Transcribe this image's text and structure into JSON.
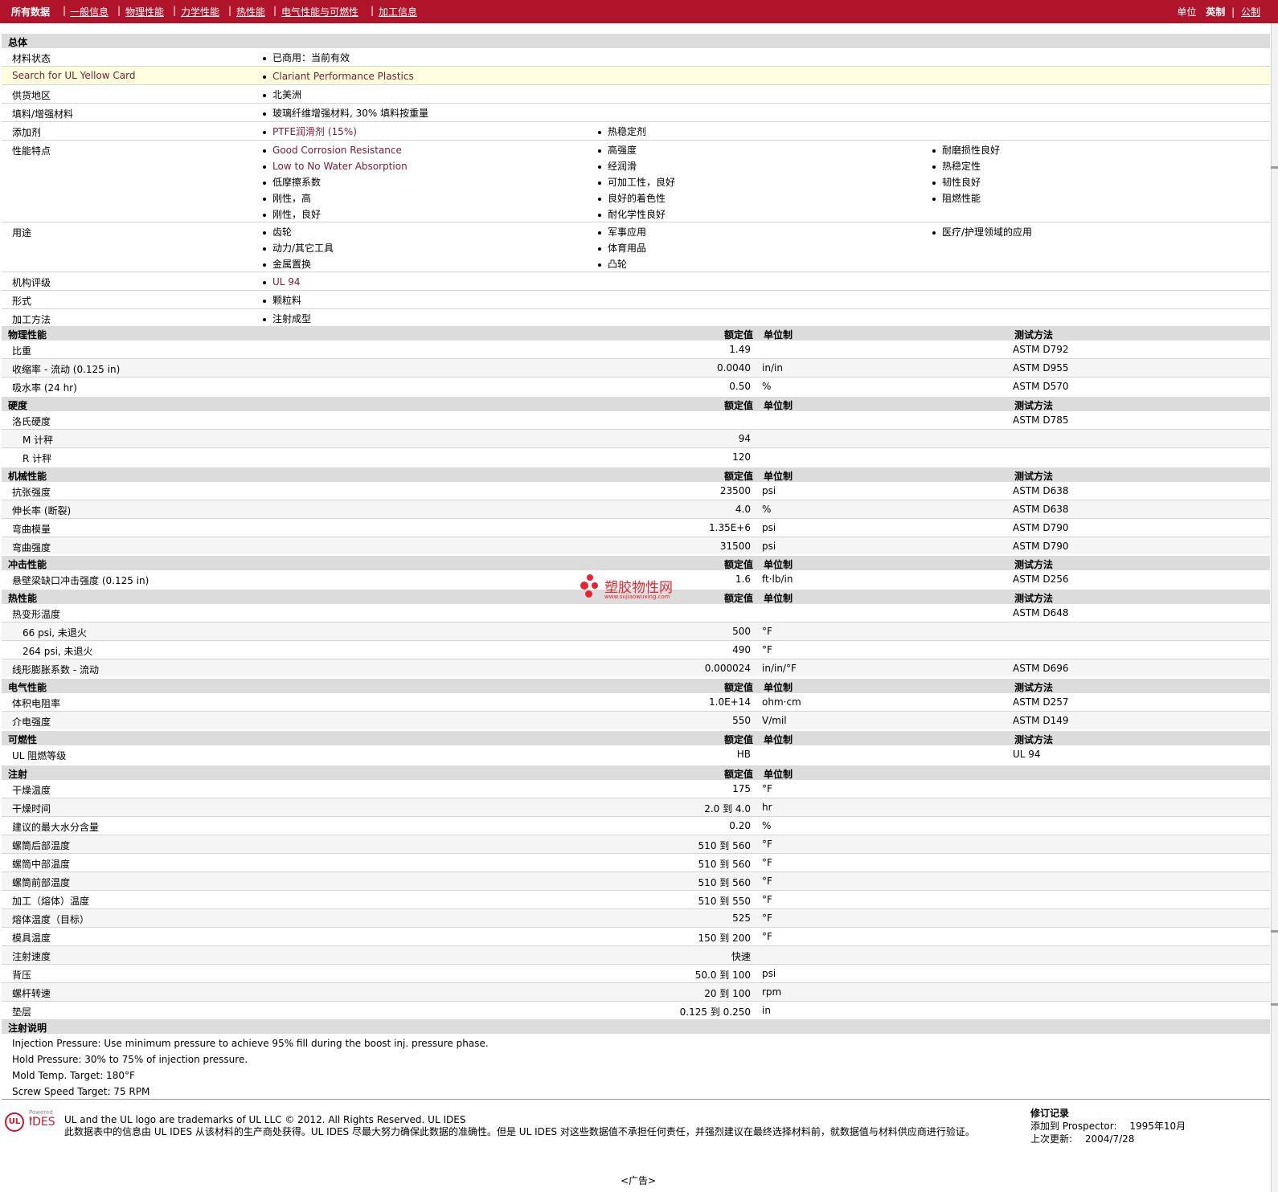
{
  "nav": {
    "tabs": [
      "所有数据",
      "一般信息",
      "物理性能",
      "力学性能",
      "热性能",
      "电气性能与可燃性",
      "加工信息"
    ],
    "separator": "|",
    "units_label": "单位",
    "unit_english": "英制",
    "unit_metric": "公制"
  },
  "sections": {
    "general": "总体",
    "physical": "物理性能",
    "hardness": "硬度",
    "mechanical": "机械性能",
    "impact": "冲击性能",
    "thermal": "热性能",
    "electrical": "电气性能",
    "flammability": "可燃性",
    "injection": "注射",
    "injection_notes": "注射说明"
  },
  "col_headers": {
    "nominal": "额定值",
    "unit": "单位制",
    "method": "测试方法"
  },
  "general": {
    "status_label": "材料状态",
    "status_value": "已商用：当前有效",
    "yellow_label": "Search for UL Yellow Card",
    "yellow_value": "Clariant Performance Plastics",
    "region_label": "供货地区",
    "region_value": "北美洲",
    "filler_label": "填料/增强材料",
    "filler_value": "玻璃纤维增强材料, 30% 填料按重量",
    "additive_label": "添加剂",
    "additive_1": "PTFE润滑剂 (15%)",
    "additive_2": "热稳定剂",
    "features_label": "性能特点",
    "features_col1": [
      "Good Corrosion Resistance",
      "Low to No Water Absorption",
      "低摩擦系数",
      "刚性，高",
      "刚性，良好"
    ],
    "features_col2": [
      "高强度",
      "经润滑",
      "可加工性，良好",
      "良好的着色性",
      "耐化学性良好"
    ],
    "features_col3": [
      "耐磨损性良好",
      "热稳定性",
      "韧性良好",
      "阻燃性能"
    ],
    "uses_label": "用途",
    "uses_col1": [
      "齿轮",
      "动力/其它工具",
      "金属置换"
    ],
    "uses_col2": [
      "军事应用",
      "体育用品",
      "凸轮"
    ],
    "uses_col3": [
      "医疗/护理领域的应用"
    ],
    "agency_label": "机构评级",
    "agency_value": "UL 94",
    "form_label": "形式",
    "form_value": "颗粒料",
    "process_label": "加工方法",
    "process_value": "注射成型"
  },
  "physical": [
    {
      "label": "比重",
      "value": "1.49",
      "unit": "",
      "method": "ASTM D792"
    },
    {
      "label": "收缩率 - 流动 (0.125 in)",
      "value": "0.0040",
      "unit": "in/in",
      "method": "ASTM D955"
    },
    {
      "label": "吸水率 (24 hr)",
      "value": "0.50",
      "unit": "%",
      "method": "ASTM D570"
    }
  ],
  "hardness": [
    {
      "label": "洛氏硬度",
      "value": "",
      "unit": "",
      "method": "ASTM D785"
    },
    {
      "label": "M 计秤",
      "value": "94",
      "unit": "",
      "method": ""
    },
    {
      "label": "R 计秤",
      "value": "120",
      "unit": "",
      "method": ""
    }
  ],
  "mechanical": [
    {
      "label": "抗张强度",
      "value": "23500",
      "unit": "psi",
      "method": "ASTM D638"
    },
    {
      "label": "伸长率 (断裂)",
      "value": "4.0",
      "unit": "%",
      "method": "ASTM D638"
    },
    {
      "label": "弯曲模量",
      "value": "1.35E+6",
      "unit": "psi",
      "method": "ASTM D790"
    },
    {
      "label": "弯曲强度",
      "value": "31500",
      "unit": "psi",
      "method": "ASTM D790"
    }
  ],
  "impact": [
    {
      "label": "悬壁梁缺口冲击强度 (0.125 in)",
      "value": "1.6",
      "unit": "ft·lb/in",
      "method": "ASTM D256"
    }
  ],
  "thermal": [
    {
      "label": "热变形温度",
      "value": "",
      "unit": "",
      "method": "ASTM D648"
    },
    {
      "label": "66 psi, 未退火",
      "value": "500",
      "unit": "°F",
      "method": ""
    },
    {
      "label": "264 psi, 未退火",
      "value": "490",
      "unit": "°F",
      "method": ""
    },
    {
      "label": "线形膨胀系数 - 流动",
      "value": "0.000024",
      "unit": "in/in/°F",
      "method": "ASTM D696"
    }
  ],
  "electrical": [
    {
      "label": "体积电阻率",
      "value": "1.0E+14",
      "unit": "ohm·cm",
      "method": "ASTM D257"
    },
    {
      "label": "介电强度",
      "value": "550",
      "unit": "V/mil",
      "method": "ASTM D149"
    }
  ],
  "flammability": [
    {
      "label": "UL 阻燃等级",
      "value": "HB",
      "unit": "",
      "method": "UL 94"
    }
  ],
  "injection": [
    {
      "label": "干燥温度",
      "value": "175",
      "unit": "°F"
    },
    {
      "label": "干燥时间",
      "value": "2.0 到 4.0",
      "unit": "hr"
    },
    {
      "label": "建议的最大水分含量",
      "value": "0.20",
      "unit": "%"
    },
    {
      "label": "螺筒后部温度",
      "value": "510 到 560",
      "unit": "°F"
    },
    {
      "label": "螺筒中部温度",
      "value": "510 到 560",
      "unit": "°F"
    },
    {
      "label": "螺筒前部温度",
      "value": "510 到 560",
      "unit": "°F"
    },
    {
      "label": "加工（熔体）温度",
      "value": "510 到 550",
      "unit": "°F"
    },
    {
      "label": "熔体温度（目标）",
      "value": "525",
      "unit": "°F"
    },
    {
      "label": "模具温度",
      "value": "150 到 200",
      "unit": "°F"
    },
    {
      "label": "注射速度",
      "value": "快速",
      "unit": ""
    },
    {
      "label": "背压",
      "value": "50.0 到 100",
      "unit": "psi"
    },
    {
      "label": "螺杆转速",
      "value": "20 到 100",
      "unit": "rpm"
    },
    {
      "label": "垫层",
      "value": "0.125 到 0.250",
      "unit": "in"
    }
  ],
  "injection_notes": [
    "Injection Pressure: Use minimum pressure to achieve 95% fill during the boost inj. pressure phase.",
    "Hold Pressure: 30% to 75% of injection pressure.",
    "Mold Temp. Target: 180°F",
    "Screw Speed Target: 75 RPM"
  ],
  "footer": {
    "logo_ul": "UL",
    "logo_ides": "IDES",
    "logo_powered": "Powered by",
    "trademark": "UL and the UL logo are trademarks of UL LLC © 2012. All Rights Reserved. UL IDES",
    "disclaimer": "此数据表中的信息由 UL IDES 从该材料的生产商处获得。UL IDES 尽最大努力确保此数据的准确性。但是 UL IDES 对这些数据值不承担任何责任，并强烈建议在最终选择材料前，就数据值与材料供应商进行验证。",
    "revision_title": "修订记录",
    "added_label": "添加到 Prospector:",
    "added_value": "1995年10月",
    "updated_label": "上次更新:",
    "updated_value": "2004/7/28",
    "ad": "<广告>"
  },
  "watermark": {
    "text": "塑胶物性网",
    "url": "www.sujiaowuxing.com"
  },
  "colors": {
    "brand_red": "#b0142a",
    "link": "#7a1b30",
    "highlight": "#ffffe0",
    "header_bg": "#dcdcdc"
  }
}
